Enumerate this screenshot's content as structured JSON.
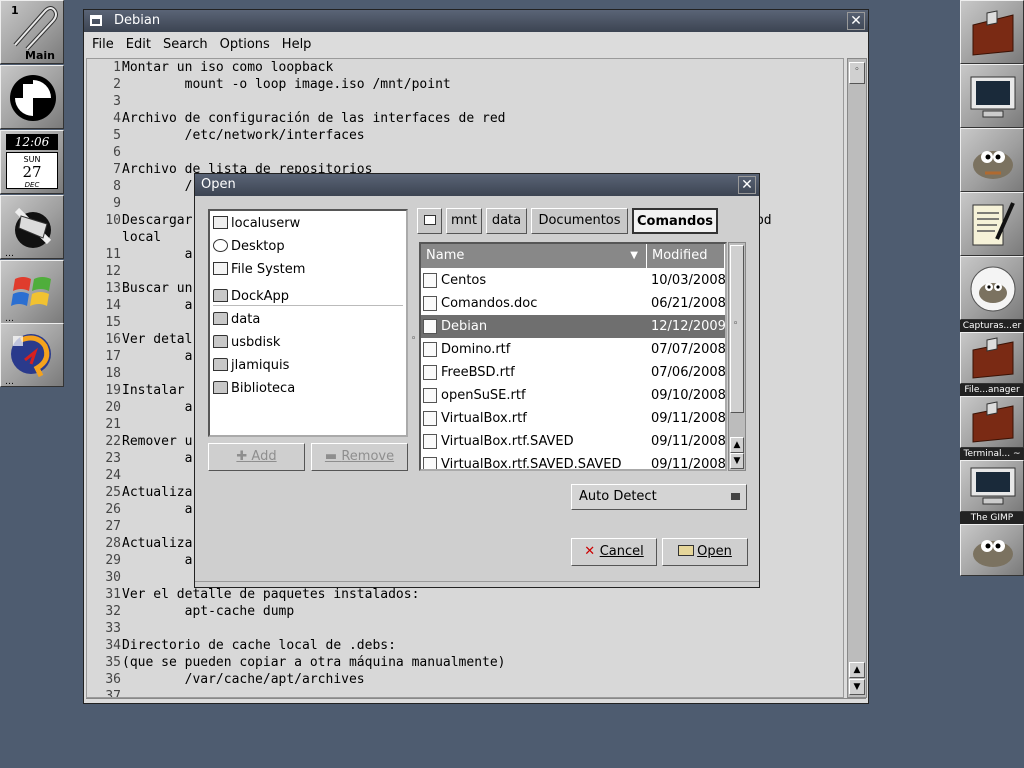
{
  "colors": {
    "desktop": "#4e5c70",
    "titlebar": "#3c4452",
    "selected_row": "#6f6f6f"
  },
  "dock_left": [
    {
      "name": "workspace-main",
      "label": "Main",
      "number": "1",
      "icon": "paperclip-icon"
    },
    {
      "name": "wmaker-clock",
      "icon": "clock-icon"
    },
    {
      "name": "calendar-clock",
      "time": "12:06",
      "weekday": "SUN",
      "day": "27",
      "month": "DEC"
    },
    {
      "name": "system-tool",
      "icon": "wrench-icon"
    },
    {
      "name": "windows-app",
      "icon": "windows-logo-icon"
    },
    {
      "name": "debian-app",
      "icon": "debian-swirl-icon"
    }
  ],
  "dock_right": [
    {
      "caption": "",
      "icon": "folder-cabinet-icon"
    },
    {
      "caption": "",
      "icon": "monitor-icon"
    },
    {
      "caption": "",
      "icon": "gimp-wilber-icon"
    },
    {
      "caption": "",
      "icon": "notepad-icon"
    },
    {
      "caption": "",
      "icon": "gimp-eye-icon"
    },
    {
      "caption": "Capturas...er",
      "icon": "folder-cabinet-icon"
    },
    {
      "caption": "File...anager",
      "icon": "folder-cabinet-icon"
    },
    {
      "caption": "Terminal... ~",
      "icon": "monitor-icon"
    },
    {
      "caption": "The GIMP",
      "icon": "gimp-wilber-icon"
    }
  ],
  "editor": {
    "title": "Debian",
    "menu": [
      "File",
      "Edit",
      "Search",
      "Options",
      "Help"
    ],
    "lines": [
      {
        "n": "1",
        "t": "Montar un iso como loopback"
      },
      {
        "n": "2",
        "t": "        mount -o loop image.iso /mnt/point"
      },
      {
        "n": "3",
        "t": ""
      },
      {
        "n": "4",
        "t": "Archivo de configuración de las interfaces de red"
      },
      {
        "n": "5",
        "t": "        /etc/network/interfaces"
      },
      {
        "n": "6",
        "t": ""
      },
      {
        "n": "7",
        "t": "Archivo de lista de repositorios"
      },
      {
        "n": "8",
        "t": "        /"
      },
      {
        "n": "9",
        "t": ""
      },
      {
        "n": "10",
        "t": "Descargar                                                                 zar la bd"
      },
      {
        "n": "",
        "t": "local"
      },
      {
        "n": "11",
        "t": "        a"
      },
      {
        "n": "12",
        "t": ""
      },
      {
        "n": "13",
        "t": "Buscar un"
      },
      {
        "n": "14",
        "t": "        a"
      },
      {
        "n": "15",
        "t": ""
      },
      {
        "n": "16",
        "t": "Ver detal"
      },
      {
        "n": "17",
        "t": "        a"
      },
      {
        "n": "18",
        "t": ""
      },
      {
        "n": "19",
        "t": "Instalar"
      },
      {
        "n": "20",
        "t": "        a"
      },
      {
        "n": "21",
        "t": ""
      },
      {
        "n": "22",
        "t": "Remover u"
      },
      {
        "n": "23",
        "t": "        a"
      },
      {
        "n": "24",
        "t": ""
      },
      {
        "n": "25",
        "t": "Actualiza"
      },
      {
        "n": "26",
        "t": "        a"
      },
      {
        "n": "27",
        "t": ""
      },
      {
        "n": "28",
        "t": "Actualiza"
      },
      {
        "n": "29",
        "t": "        a"
      },
      {
        "n": "30",
        "t": ""
      },
      {
        "n": "31",
        "t": "Ver el detalle de paquetes instalados:"
      },
      {
        "n": "32",
        "t": "        apt-cache dump"
      },
      {
        "n": "33",
        "t": ""
      },
      {
        "n": "34",
        "t": "Directorio de cache local de .debs:"
      },
      {
        "n": "35",
        "t": "(que se pueden copiar a otra máquina manualmente)"
      },
      {
        "n": "36",
        "t": "        /var/cache/apt/archives"
      },
      {
        "n": "37",
        "t": ""
      }
    ]
  },
  "dialog": {
    "title": "Open",
    "places": [
      {
        "label": "localuserw",
        "icon": "home-folder-icon"
      },
      {
        "label": "Desktop",
        "icon": "desktop-icon"
      },
      {
        "label": "File System",
        "icon": "drive-icon"
      },
      {
        "label": "DockApp",
        "icon": "folder-icon"
      },
      {
        "label": "data",
        "icon": "folder-icon"
      },
      {
        "label": "usbdisk",
        "icon": "folder-icon"
      },
      {
        "label": "jlamiquis",
        "icon": "folder-icon"
      },
      {
        "label": "Biblioteca",
        "icon": "folder-icon"
      }
    ],
    "add_label": "Add",
    "remove_label": "Remove",
    "breadcrumbs": [
      "mnt",
      "data",
      "Documentos",
      "Comandos"
    ],
    "columns": {
      "name": "Name",
      "modified": "Modified"
    },
    "files": [
      {
        "name": "Centos",
        "modified": "10/03/2008",
        "selected": false
      },
      {
        "name": "Comandos.doc",
        "modified": "06/21/2008",
        "selected": false
      },
      {
        "name": "Debian",
        "modified": "12/12/2009",
        "selected": true
      },
      {
        "name": "Domino.rtf",
        "modified": "07/07/2008",
        "selected": false
      },
      {
        "name": "FreeBSD.rtf",
        "modified": "07/06/2008",
        "selected": false
      },
      {
        "name": "openSuSE.rtf",
        "modified": "09/10/2008",
        "selected": false
      },
      {
        "name": "VirtualBox.rtf",
        "modified": "09/11/2008",
        "selected": false
      },
      {
        "name": "VirtualBox.rtf.SAVED",
        "modified": "09/11/2008",
        "selected": false
      },
      {
        "name": "VirtualBox.rtf.SAVED.SAVED",
        "modified": "09/11/2008",
        "selected": false
      }
    ],
    "filter_value": "Auto Detect",
    "cancel_label": "Cancel",
    "open_label": "Open"
  }
}
